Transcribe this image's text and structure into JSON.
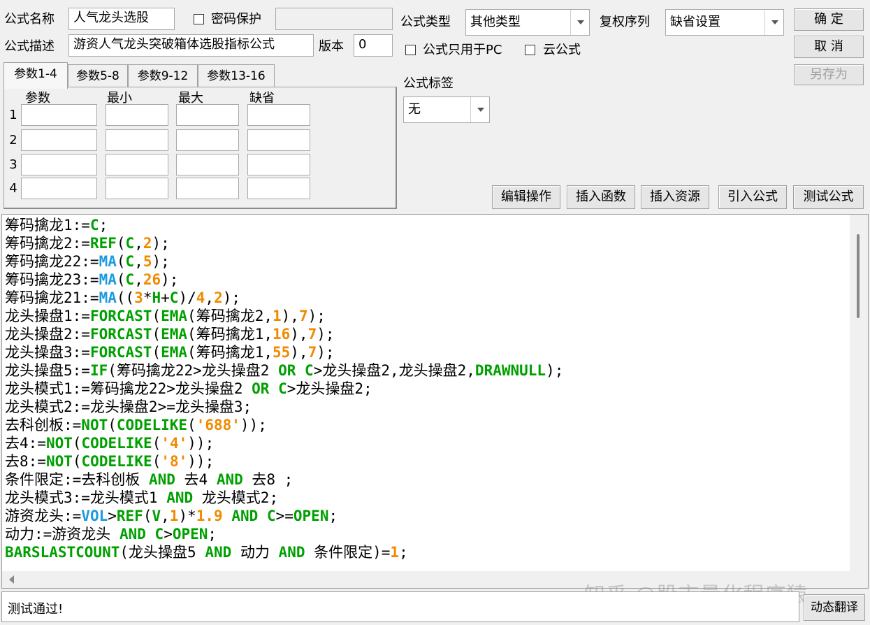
{
  "header": {
    "name_label": "公式名称",
    "name_value": "人气龙头选股",
    "password_label": "密码保护",
    "password_value": "",
    "desc_label": "公式描述",
    "desc_value": "游资人气龙头突破箱体选股指标公式",
    "version_label": "版本",
    "version_value": "0",
    "type_label": "公式类型",
    "type_value": "其他类型",
    "rights_label": "复权序列",
    "rights_value": "缺省设置",
    "pc_only_label": "公式只用于PC",
    "cloud_label": "云公式",
    "tag_label": "公式标签",
    "tag_value": "无"
  },
  "buttons": {
    "ok": "确 定",
    "cancel": "取 消",
    "save_as": "另存为",
    "edit_op": "编辑操作",
    "insert_func": "插入函数",
    "insert_res": "插入资源",
    "import_formula": "引入公式",
    "test_formula": "测试公式",
    "dynamic_translate": "动态翻译"
  },
  "param_tabs": [
    "参数1-4",
    "参数5-8",
    "参数9-12",
    "参数13-16"
  ],
  "param_table": {
    "headers": [
      "参数",
      "最小",
      "最大",
      "缺省"
    ],
    "rows": [
      "1",
      "2",
      "3",
      "4"
    ]
  },
  "code_lines": [
    [
      [
        "t",
        "筹码擒龙1:="
      ],
      [
        "k",
        "C"
      ],
      [
        "t",
        ";"
      ]
    ],
    [
      [
        "t",
        "筹码擒龙2:="
      ],
      [
        "k",
        "REF"
      ],
      [
        "t",
        "("
      ],
      [
        "k",
        "C"
      ],
      [
        "t",
        ","
      ],
      [
        "n",
        "2"
      ],
      [
        "t",
        ");"
      ]
    ],
    [
      [
        "t",
        "筹码擒龙22:="
      ],
      [
        "f",
        "MA"
      ],
      [
        "t",
        "("
      ],
      [
        "k",
        "C"
      ],
      [
        "t",
        ","
      ],
      [
        "n",
        "5"
      ],
      [
        "t",
        ");"
      ]
    ],
    [
      [
        "t",
        "筹码擒龙23:="
      ],
      [
        "f",
        "MA"
      ],
      [
        "t",
        "("
      ],
      [
        "k",
        "C"
      ],
      [
        "t",
        ","
      ],
      [
        "n",
        "26"
      ],
      [
        "t",
        ");"
      ]
    ],
    [
      [
        "t",
        "筹码擒龙21:="
      ],
      [
        "f",
        "MA"
      ],
      [
        "t",
        "(("
      ],
      [
        "n",
        "3"
      ],
      [
        "t",
        "*"
      ],
      [
        "k",
        "H"
      ],
      [
        "t",
        "+"
      ],
      [
        "k",
        "C"
      ],
      [
        "t",
        ")/"
      ],
      [
        "n",
        "4"
      ],
      [
        "t",
        ","
      ],
      [
        "n",
        "2"
      ],
      [
        "t",
        ");"
      ]
    ],
    [
      [
        "t",
        "龙头操盘1:="
      ],
      [
        "k",
        "FORCAST"
      ],
      [
        "t",
        "("
      ],
      [
        "k",
        "EMA"
      ],
      [
        "t",
        "(筹码擒龙2,"
      ],
      [
        "n",
        "1"
      ],
      [
        "t",
        "),"
      ],
      [
        "n",
        "7"
      ],
      [
        "t",
        ");"
      ]
    ],
    [
      [
        "t",
        "龙头操盘2:="
      ],
      [
        "k",
        "FORCAST"
      ],
      [
        "t",
        "("
      ],
      [
        "k",
        "EMA"
      ],
      [
        "t",
        "(筹码擒龙1,"
      ],
      [
        "n",
        "16"
      ],
      [
        "t",
        "),"
      ],
      [
        "n",
        "7"
      ],
      [
        "t",
        ");"
      ]
    ],
    [
      [
        "t",
        "龙头操盘3:="
      ],
      [
        "k",
        "FORCAST"
      ],
      [
        "t",
        "("
      ],
      [
        "k",
        "EMA"
      ],
      [
        "t",
        "(筹码擒龙1,"
      ],
      [
        "n",
        "55"
      ],
      [
        "t",
        "),"
      ],
      [
        "n",
        "7"
      ],
      [
        "t",
        ");"
      ]
    ],
    [
      [
        "t",
        "龙头操盘5:="
      ],
      [
        "k",
        "IF"
      ],
      [
        "t",
        "(筹码擒龙22>龙头操盘2 "
      ],
      [
        "k",
        "OR"
      ],
      [
        "t",
        " "
      ],
      [
        "k",
        "C"
      ],
      [
        "t",
        ">龙头操盘2,龙头操盘2,"
      ],
      [
        "k",
        "DRAWNULL"
      ],
      [
        "t",
        ");"
      ]
    ],
    [
      [
        "t",
        "龙头模式1:=筹码擒龙22>龙头操盘2 "
      ],
      [
        "k",
        "OR"
      ],
      [
        "t",
        " "
      ],
      [
        "k",
        "C"
      ],
      [
        "t",
        ">龙头操盘2;"
      ]
    ],
    [
      [
        "t",
        "龙头模式2:=龙头操盘2>=龙头操盘3;"
      ]
    ],
    [
      [
        "t",
        "去科创板:="
      ],
      [
        "k",
        "NOT"
      ],
      [
        "t",
        "("
      ],
      [
        "k",
        "CODELIKE"
      ],
      [
        "t",
        "("
      ],
      [
        "s",
        "'688'"
      ],
      [
        "t",
        "));"
      ]
    ],
    [
      [
        "t",
        "去4:="
      ],
      [
        "k",
        "NOT"
      ],
      [
        "t",
        "("
      ],
      [
        "k",
        "CODELIKE"
      ],
      [
        "t",
        "("
      ],
      [
        "s",
        "'4'"
      ],
      [
        "t",
        "));"
      ]
    ],
    [
      [
        "t",
        "去8:="
      ],
      [
        "k",
        "NOT"
      ],
      [
        "t",
        "("
      ],
      [
        "k",
        "CODELIKE"
      ],
      [
        "t",
        "("
      ],
      [
        "s",
        "'8'"
      ],
      [
        "t",
        "));"
      ]
    ],
    [
      [
        "t",
        "条件限定:=去科创板 "
      ],
      [
        "k",
        "AND"
      ],
      [
        "t",
        " 去4 "
      ],
      [
        "k",
        "AND"
      ],
      [
        "t",
        " 去8 ;"
      ]
    ],
    [
      [
        "t",
        "龙头模式3:=龙头模式1 "
      ],
      [
        "k",
        "AND"
      ],
      [
        "t",
        " 龙头模式2;"
      ]
    ],
    [
      [
        "t",
        "游资龙头:="
      ],
      [
        "f",
        "VOL"
      ],
      [
        "t",
        ">"
      ],
      [
        "k",
        "REF"
      ],
      [
        "t",
        "("
      ],
      [
        "k",
        "V"
      ],
      [
        "t",
        ","
      ],
      [
        "n",
        "1"
      ],
      [
        "t",
        ")*"
      ],
      [
        "n",
        "1.9"
      ],
      [
        "t",
        " "
      ],
      [
        "k",
        "AND"
      ],
      [
        "t",
        " "
      ],
      [
        "k",
        "C"
      ],
      [
        "t",
        ">="
      ],
      [
        "k",
        "OPEN"
      ],
      [
        "t",
        ";"
      ]
    ],
    [
      [
        "t",
        "动力:=游资龙头 "
      ],
      [
        "k",
        "AND"
      ],
      [
        "t",
        " "
      ],
      [
        "k",
        "C"
      ],
      [
        "t",
        ">"
      ],
      [
        "k",
        "OPEN"
      ],
      [
        "t",
        ";"
      ]
    ],
    [
      [
        "k",
        "BARSLASTCOUNT"
      ],
      [
        "t",
        "(龙头操盘5 "
      ],
      [
        "k",
        "AND"
      ],
      [
        "t",
        " 动力 "
      ],
      [
        "k",
        "AND"
      ],
      [
        "t",
        " 条件限定)="
      ],
      [
        "n",
        "1"
      ],
      [
        "t",
        ";"
      ]
    ]
  ],
  "status": {
    "text": "测试通过!"
  },
  "watermark": "知乎 @股市量化程序猿",
  "colors": {
    "keyword": "#00a000",
    "function": "#1e9ae0",
    "number": "#f08a00"
  }
}
